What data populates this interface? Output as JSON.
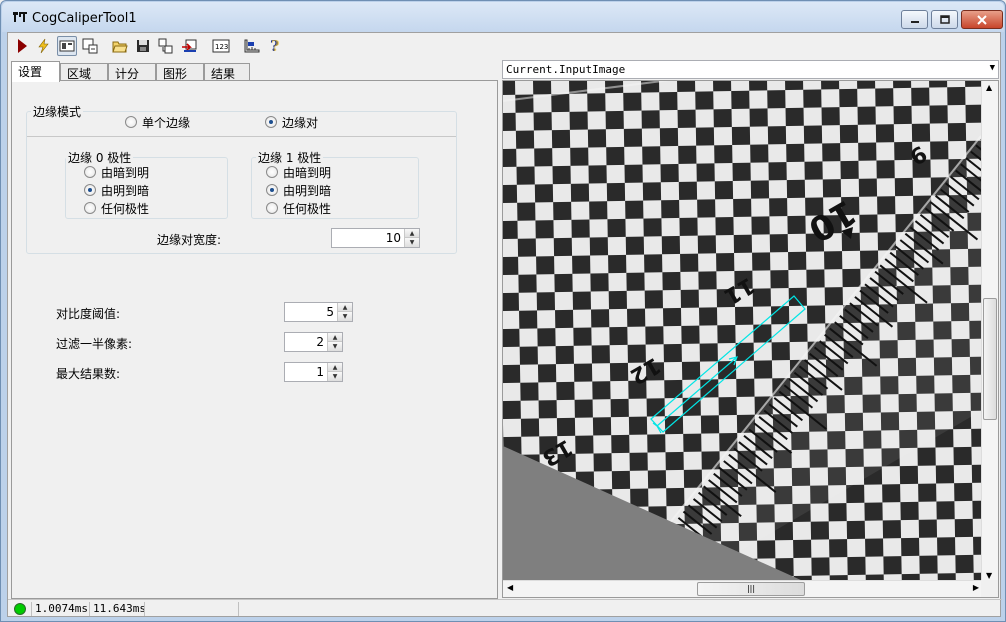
{
  "window": {
    "title": "CogCaliperTool1"
  },
  "toolbar": {
    "icons": [
      "run-icon",
      "electric-icon",
      "show-image-icon",
      "local-graphics-icon",
      "open-icon",
      "save-icon",
      "tool-output-icon",
      "reset-icon",
      "terminal-icon",
      "ruler-icon",
      "help-icon"
    ]
  },
  "tabs": [
    {
      "label": "设置",
      "active": true
    },
    {
      "label": "区域",
      "active": false
    },
    {
      "label": "计分",
      "active": false
    },
    {
      "label": "图形",
      "active": false
    },
    {
      "label": "结果",
      "active": false
    }
  ],
  "settings": {
    "edge_mode": {
      "legend": "边缘模式",
      "options": [
        {
          "label": "单个边缘",
          "selected": false
        },
        {
          "label": "边缘对",
          "selected": true
        }
      ]
    },
    "edge0": {
      "legend": "边缘 0 极性",
      "options": [
        {
          "label": "由暗到明",
          "selected": false
        },
        {
          "label": "由明到暗",
          "selected": true
        },
        {
          "label": "任何极性",
          "selected": false
        }
      ]
    },
    "edge1": {
      "legend": "边缘 1 极性",
      "options": [
        {
          "label": "由暗到明",
          "selected": false
        },
        {
          "label": "由明到暗",
          "selected": true
        },
        {
          "label": "任何极性",
          "selected": false
        }
      ]
    },
    "edge_pair_width": {
      "label": "边缘对宽度:",
      "value": "10"
    },
    "contrast_threshold": {
      "label": "对比度阈值:",
      "value": "5"
    },
    "filter_half_pixels": {
      "label": "过滤一半像素:",
      "value": "2"
    },
    "max_results": {
      "label": "最大结果数:",
      "value": "1"
    }
  },
  "image_selector": {
    "value": "Current.InputImage"
  },
  "ruler_numbers": [
    "9",
    "10",
    "11",
    "12",
    "13"
  ],
  "status": {
    "indicator_color": "#00cc00",
    "time1": "1.0074ms",
    "time2": "11.643ms"
  },
  "colors": {
    "caliper_region": "#00e5e5"
  }
}
